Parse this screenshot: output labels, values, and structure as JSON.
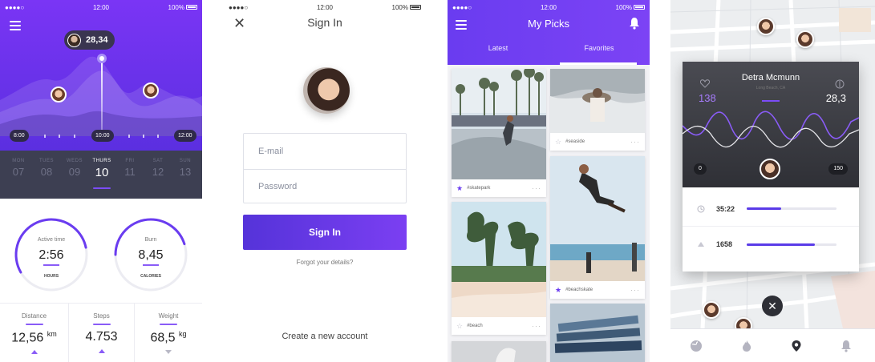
{
  "colors": {
    "accent": "#6a3cf0",
    "accent_light": "#8a5cf7",
    "dark_panel": "#3d3f52"
  },
  "screen_activity": {
    "status": {
      "carrier": "●●●●○",
      "time": "12:00",
      "battery": "100%"
    },
    "bubble_value": "28,34",
    "time_chips": {
      "start": "8:00",
      "current": "10:00",
      "end": "12:00"
    },
    "days": [
      {
        "name": "MON",
        "num": "07"
      },
      {
        "name": "TUES",
        "num": "08"
      },
      {
        "name": "WEDS",
        "num": "09"
      },
      {
        "name": "THURS",
        "num": "10"
      },
      {
        "name": "FRI",
        "num": "11"
      },
      {
        "name": "SAT",
        "num": "12"
      },
      {
        "name": "SUN",
        "num": "13"
      }
    ],
    "active_day_index": 3,
    "rings": [
      {
        "label": "Active time",
        "value": "2:56",
        "unit": "HOURS",
        "fraction": 0.55
      },
      {
        "label": "Burn",
        "value": "8,45",
        "unit": "CALORIES",
        "fraction": 0.45
      }
    ],
    "metrics": [
      {
        "label": "Distance",
        "value": "12,56",
        "unit": "km",
        "trend": "up"
      },
      {
        "label": "Steps",
        "value": "4.753",
        "unit": "",
        "trend": "up"
      },
      {
        "label": "Weight",
        "value": "68,5",
        "unit": "kg",
        "trend": "down"
      }
    ]
  },
  "screen_signin": {
    "status": {
      "carrier": "●●●●○",
      "time": "12:00",
      "battery": "100%"
    },
    "title": "Sign In",
    "close_glyph": "✕",
    "email_placeholder": "E-mail",
    "password_placeholder": "Password",
    "button_label": "Sign In",
    "forgot_label": "Forgot your details?",
    "create_label": "Create a new account"
  },
  "screen_picks": {
    "status": {
      "carrier": "●●●●○",
      "time": "12:00",
      "battery": "100%"
    },
    "title": "My Picks",
    "tabs": [
      "Latest",
      "Favorites"
    ],
    "active_tab_index": 1,
    "cards": [
      {
        "tag": "#skatepark",
        "starred": true
      },
      {
        "tag": "#seaside",
        "starred": false
      },
      {
        "tag": "#beach",
        "starred": false
      },
      {
        "tag": "#beachskate",
        "starred": true
      }
    ],
    "more_glyph": "···"
  },
  "screen_map": {
    "name": "Detra Mcmunn",
    "location": "Long Beach, CA",
    "left_value": "138",
    "right_value": "28,3",
    "chip_start": "0",
    "chip_end": "150",
    "stats": [
      {
        "value": "35:22",
        "fraction": 0.38,
        "icon": "clock-icon"
      },
      {
        "value": "1658",
        "fraction": 0.76,
        "icon": "mountain-icon"
      }
    ],
    "close_glyph": "✕",
    "tab_icons": [
      "globe-icon",
      "flame-icon",
      "pin-icon",
      "bell-icon"
    ],
    "active_tab_index": 2
  }
}
